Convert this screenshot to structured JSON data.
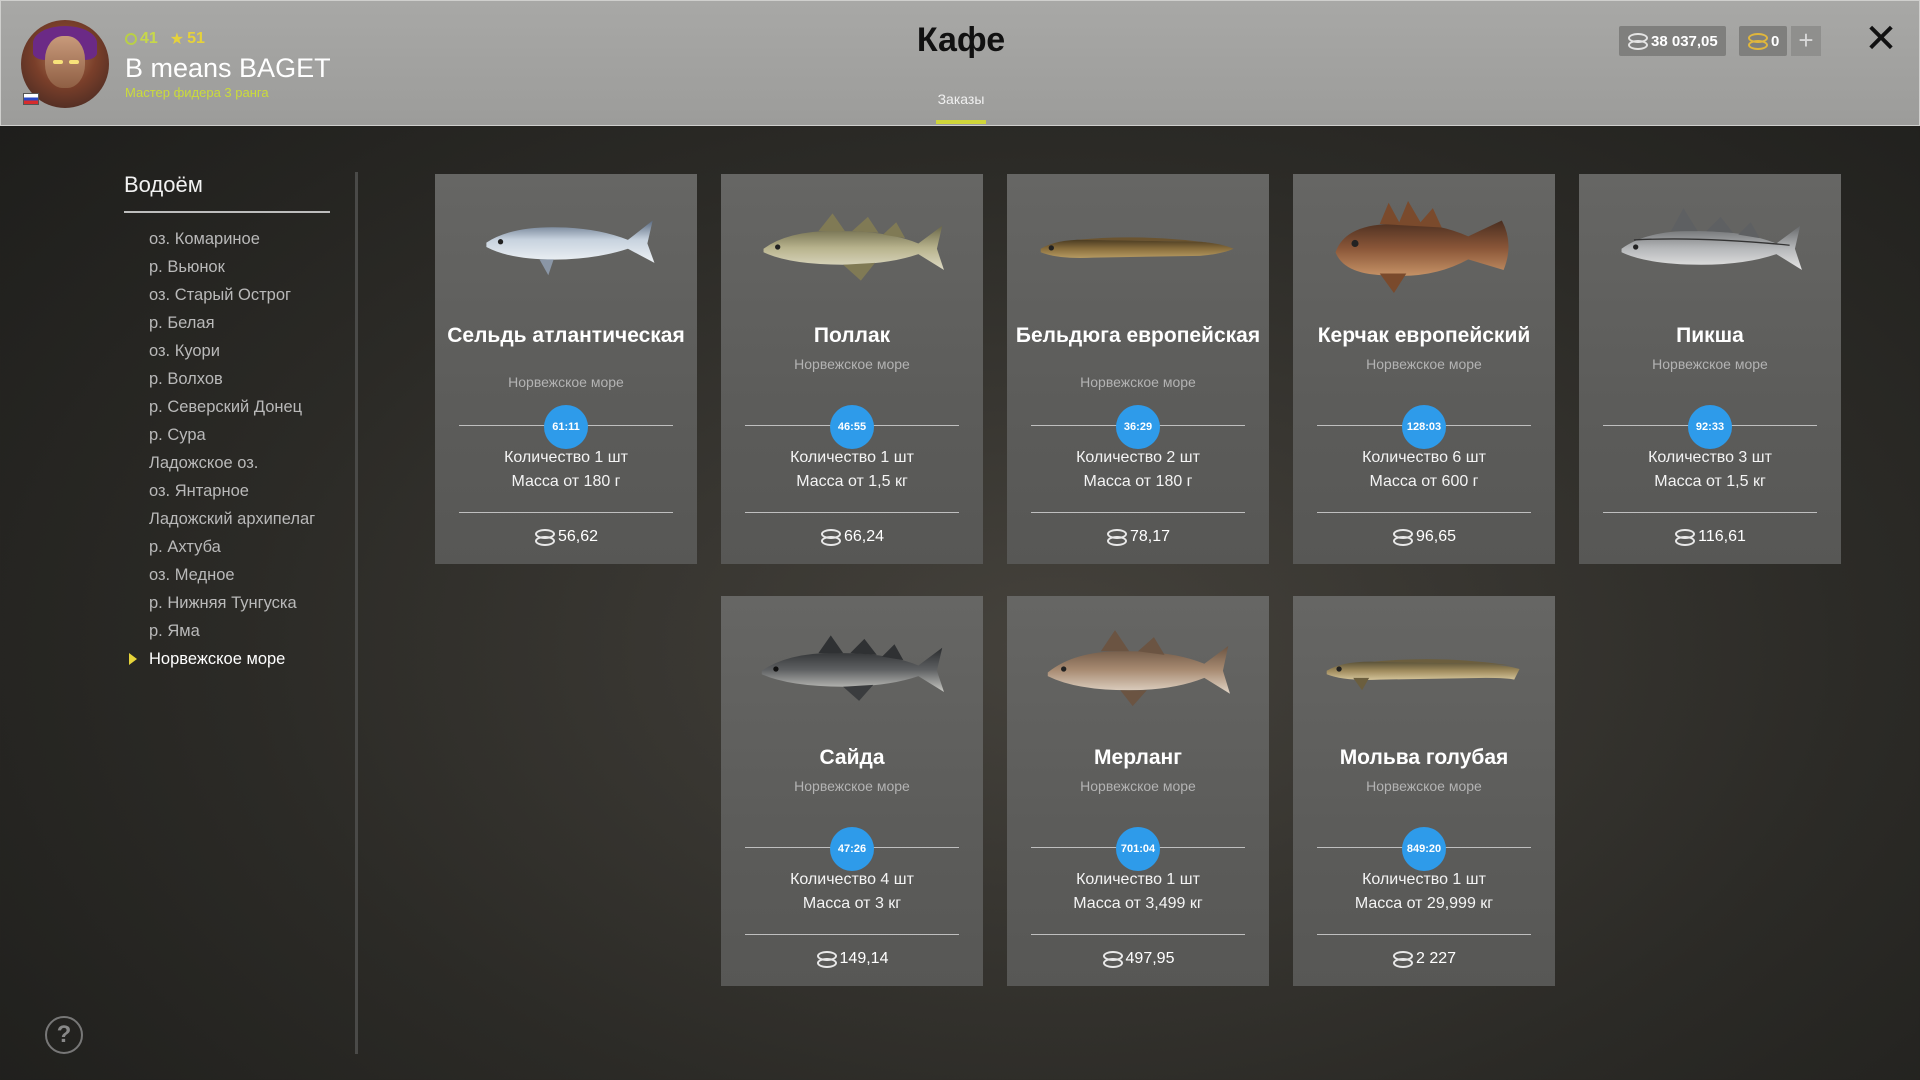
{
  "player": {
    "level": "41",
    "stars": "51",
    "name": "B means BAGET",
    "rank": "Мастер фидера 3 ранга"
  },
  "header": {
    "title": "Кафе",
    "tab": "Заказы",
    "silver": "38 037,05",
    "gold": "0",
    "plus": "+",
    "close": "✕"
  },
  "sidebar": {
    "title": "Водоём",
    "lakes": [
      "оз. Комариное",
      "р. Вьюнок",
      "оз. Старый Острог",
      "р. Белая",
      "оз. Куори",
      "р. Волхов",
      "р. Северский Донец",
      "р. Сура",
      "Ладожское оз.",
      "оз. Янтарное",
      "Ладожский архипелаг",
      "р. Ахтуба",
      "оз. Медное",
      "р. Нижняя Тунгуска",
      "р. Яма",
      "Норвежское море"
    ],
    "active_index": 15
  },
  "help": "?",
  "orders": [
    {
      "name": "Сельдь атлантическая",
      "region": "Норвежское море",
      "timer": "61:11",
      "qty": "Количество 1 шт",
      "mass": "Масса от 180 г",
      "price": "56,62"
    },
    {
      "name": "Поллак",
      "region": "Норвежское море",
      "timer": "46:55",
      "qty": "Количество 1 шт",
      "mass": "Масса от 1,5 кг",
      "price": "66,24"
    },
    {
      "name": "Бельдюга европейская",
      "region": "Норвежское море",
      "timer": "36:29",
      "qty": "Количество 2 шт",
      "mass": "Масса от 180 г",
      "price": "78,17"
    },
    {
      "name": "Керчак европейский",
      "region": "Норвежское море",
      "timer": "128:03",
      "qty": "Количество 6 шт",
      "mass": "Масса от 600 г",
      "price": "96,65"
    },
    {
      "name": "Пикша",
      "region": "Норвежское море",
      "timer": "92:33",
      "qty": "Количество 3 шт",
      "mass": "Масса от 1,5 кг",
      "price": "116,61"
    },
    {
      "name": "Сайда",
      "region": "Норвежское море",
      "timer": "47:26",
      "qty": "Количество 4 шт",
      "mass": "Масса от 3 кг",
      "price": "149,14"
    },
    {
      "name": "Мерланг",
      "region": "Норвежское море",
      "timer": "701:04",
      "qty": "Количество 1 шт",
      "mass": "Масса от 3,499 кг",
      "price": "497,95"
    },
    {
      "name": "Мольва голубая",
      "region": "Норвежское море",
      "timer": "849:20",
      "qty": "Количество 1 шт",
      "mass": "Масса от 29,999 кг",
      "price": "2 227"
    }
  ],
  "colors": {
    "timer": "#2e9bea",
    "accent": "#cfd53a",
    "active_arrow": "#e6d43a"
  }
}
